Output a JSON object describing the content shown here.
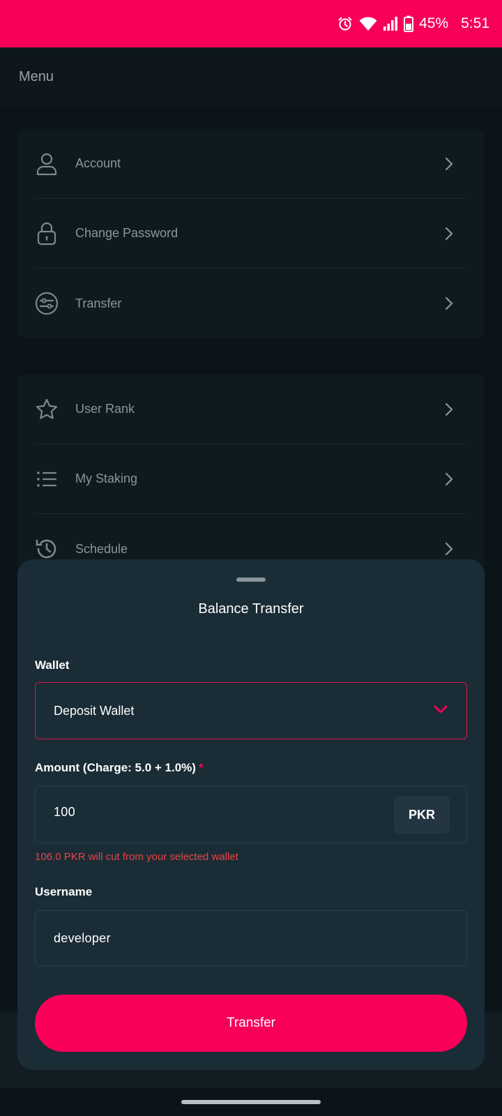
{
  "status_bar": {
    "battery": "45%",
    "time": "5:51"
  },
  "topbar": {
    "title": "Menu"
  },
  "menu_group_1": [
    {
      "label": "Account",
      "icon": "user-icon"
    },
    {
      "label": "Change Password",
      "icon": "lock-icon"
    },
    {
      "label": "Transfer",
      "icon": "transfer-icon"
    }
  ],
  "menu_group_2": [
    {
      "label": "User Rank",
      "icon": "star-icon"
    },
    {
      "label": "My Staking",
      "icon": "list-icon"
    },
    {
      "label": "Schedule",
      "icon": "history-icon"
    }
  ],
  "sheet": {
    "title": "Balance Transfer",
    "wallet_label": "Wallet",
    "wallet_value": "Deposit Wallet",
    "amount_label": "Amount (Charge: 5.0  + 1.0%)",
    "amount_required": "*",
    "amount_value": "100",
    "currency": "PKR",
    "hint": "106.0 PKR will cut from your selected wallet",
    "username_label": "Username",
    "username_value": "developer",
    "submit_label": "Transfer"
  },
  "colors": {
    "accent": "#f8005a",
    "background": "#0b1419",
    "sheet": "#1a2c36",
    "error": "#e84444"
  }
}
